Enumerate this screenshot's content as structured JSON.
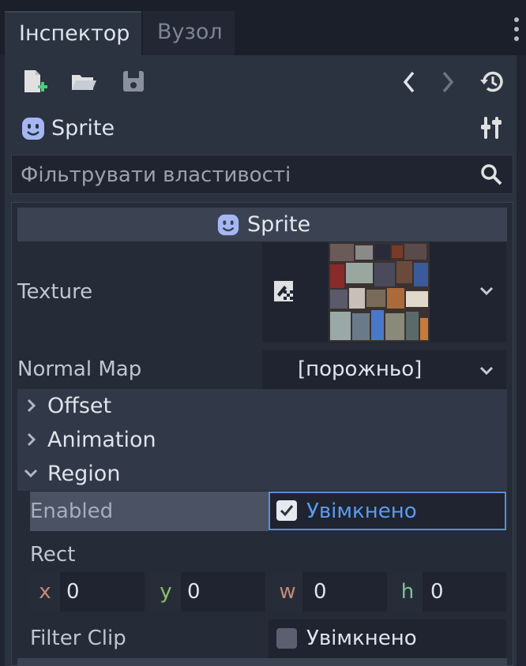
{
  "tabs": [
    {
      "label": "Інспектор",
      "active": true
    },
    {
      "label": "Вузол",
      "active": false
    }
  ],
  "toolbar": {
    "icons": [
      "new-resource-icon",
      "open-folder-icon",
      "save-icon",
      "history-back-icon",
      "history-forward-icon",
      "history-icon"
    ]
  },
  "object": {
    "name": "Sprite"
  },
  "filter": {
    "placeholder": "Фільтрувати властивості"
  },
  "section_header": {
    "label": "Sprite"
  },
  "properties": {
    "texture_label": "Texture",
    "normal_map_label": "Normal Map",
    "normal_map_value": "[порожньо]",
    "groups": [
      {
        "label": "Offset",
        "expanded": false
      },
      {
        "label": "Animation",
        "expanded": false
      },
      {
        "label": "Region",
        "expanded": true
      }
    ],
    "enabled_label": "Enabled",
    "enabled_value": "Увімкнено",
    "enabled_checked": true,
    "rect_label": "Rect",
    "rect": [
      {
        "tag": "x",
        "value": "0"
      },
      {
        "tag": "y",
        "value": "0"
      },
      {
        "tag": "w",
        "value": "0"
      },
      {
        "tag": "h",
        "value": "0"
      }
    ],
    "filter_clip_label": "Filter Clip",
    "filter_clip_value": "Увімкнено",
    "filter_clip_checked": false
  },
  "colors": {
    "accent": "#5a8fd8",
    "tag_x": "#c58a78",
    "tag_y": "#8fbf6a",
    "tag_w": "#c58a78",
    "tag_h": "#7fbf9a"
  }
}
